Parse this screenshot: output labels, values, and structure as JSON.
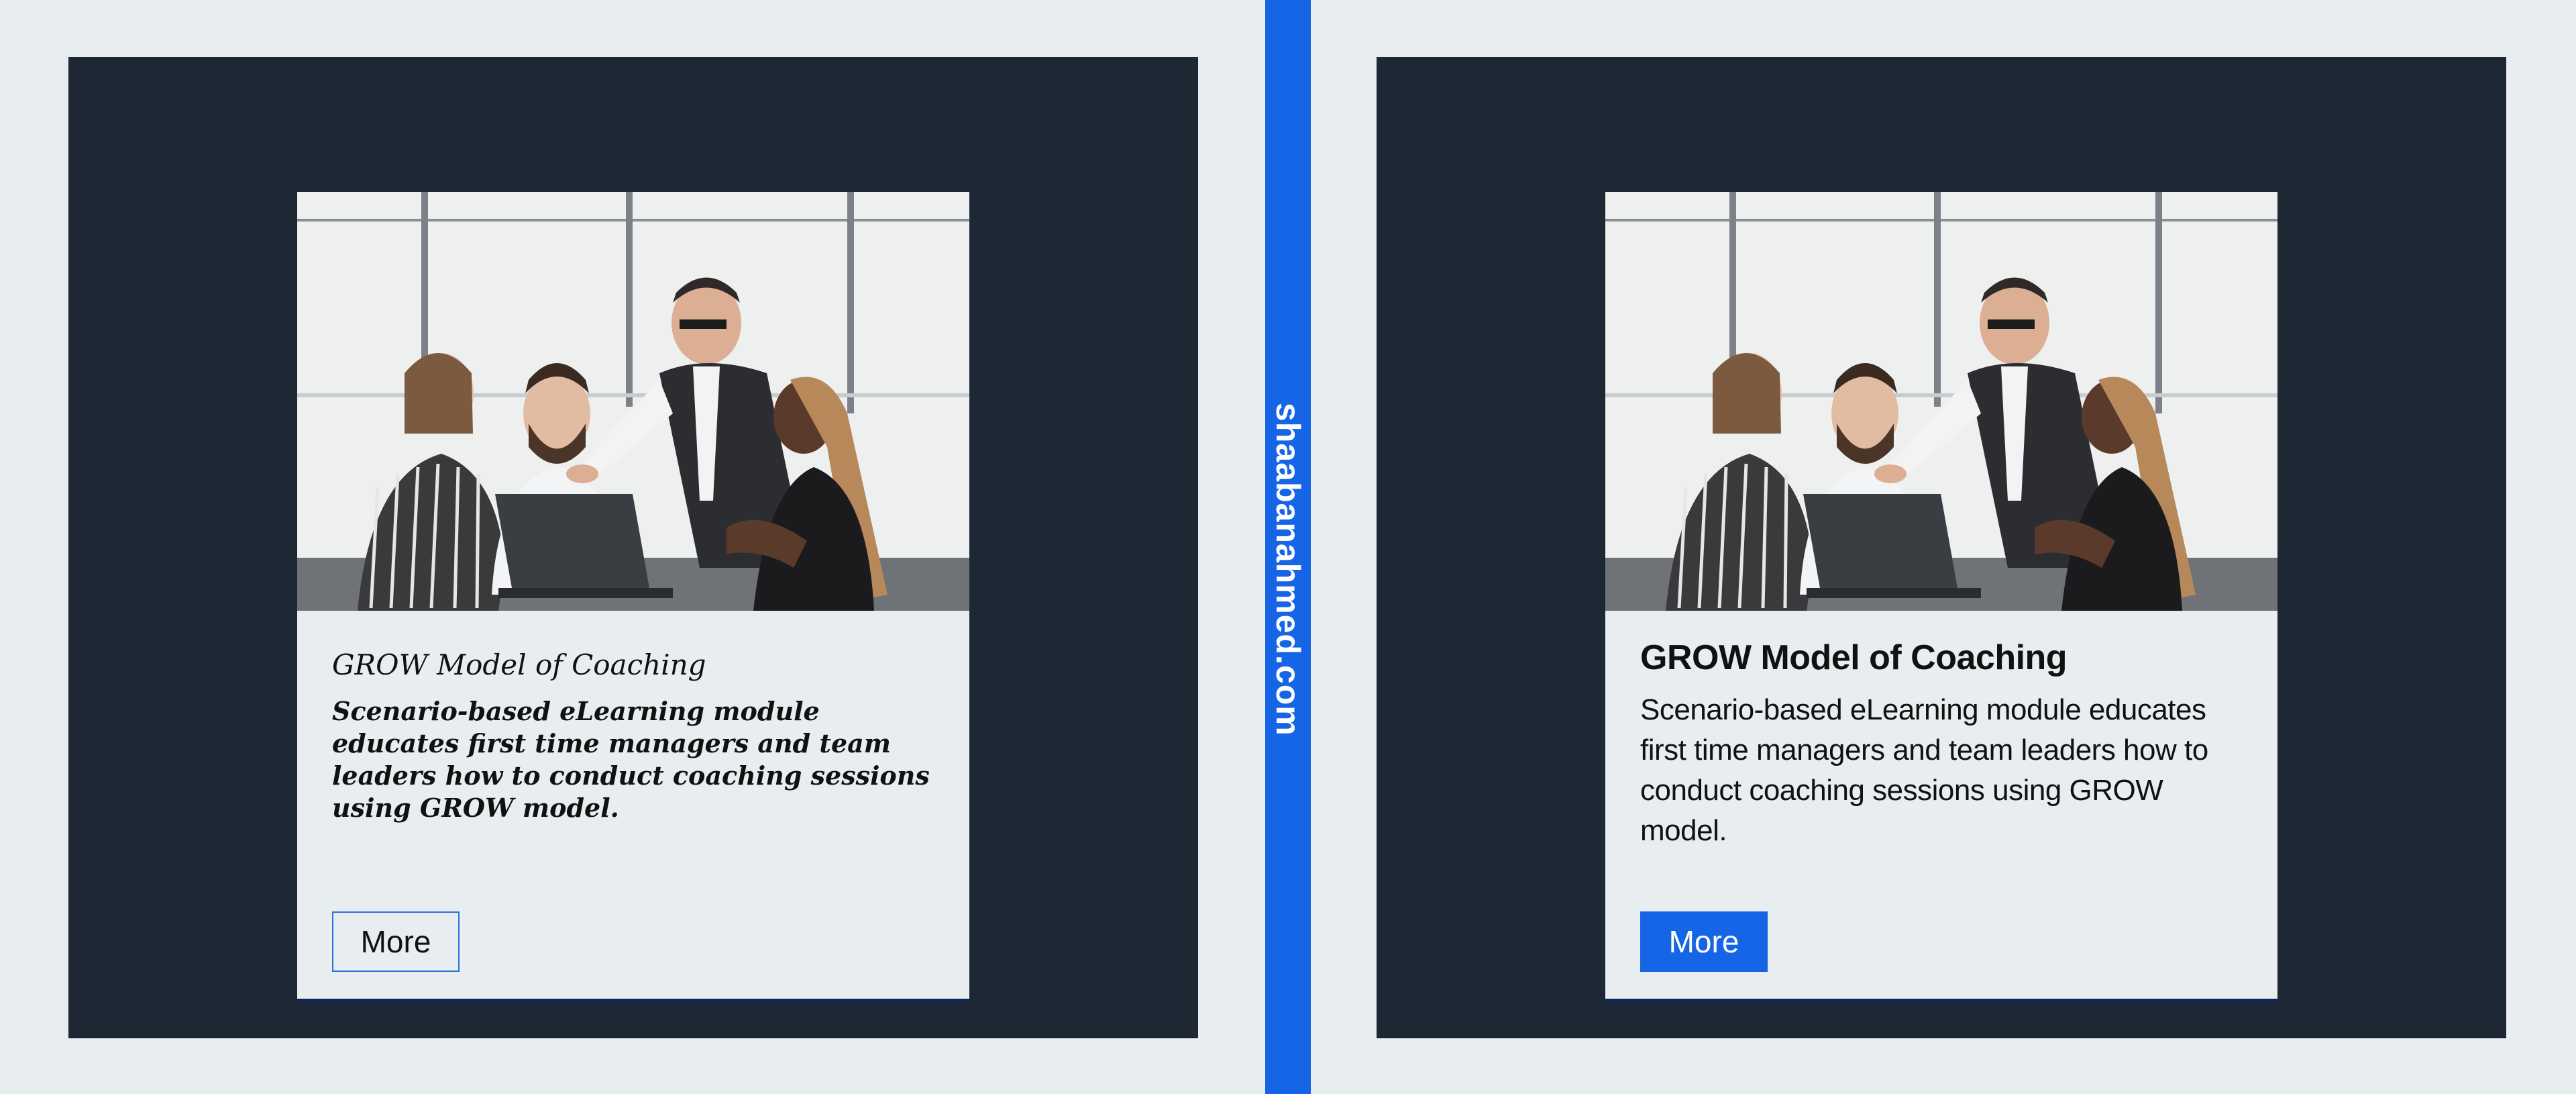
{
  "watermark": "shaabanahmed.com",
  "colors": {
    "background": "#e8edf0",
    "panel": "#1e2734",
    "accent": "#1565e6",
    "card": "#e8edf0"
  },
  "cards": [
    {
      "variant": "before",
      "image_alt": "Team meeting around a laptop",
      "title": "GROW Model of Coaching",
      "description": "Scenario-based eLearning module educates first time managers and team leaders how to conduct coaching sessions using GROW model.",
      "button_label": "More"
    },
    {
      "variant": "after",
      "image_alt": "Team meeting around a laptop",
      "title": "GROW Model of Coaching",
      "description": "Scenario-based eLearning module educates first time managers and team leaders how to conduct coaching sessions using GROW model.",
      "button_label": "More"
    }
  ]
}
